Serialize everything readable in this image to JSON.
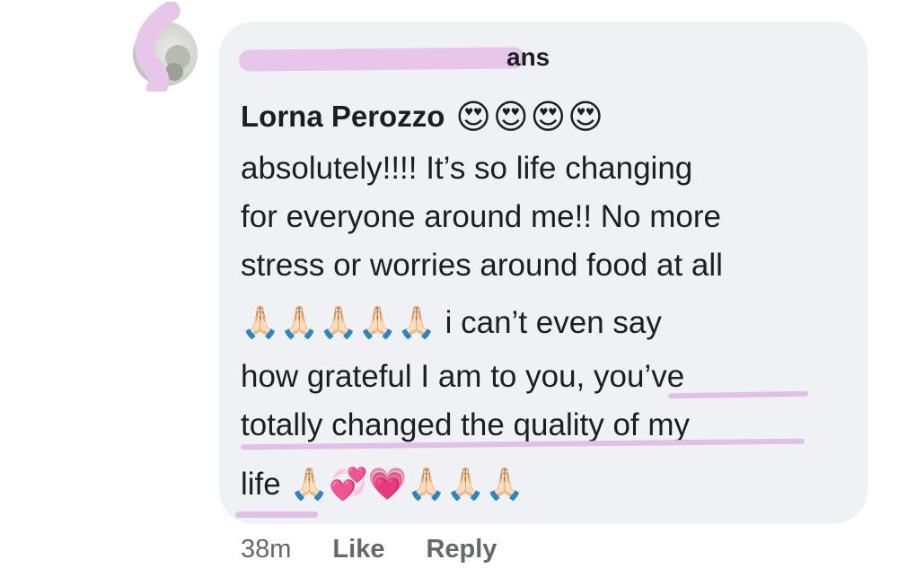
{
  "comment": {
    "redacted_name_tail": "ans",
    "author": "Lorna Perozzo",
    "author_emojis": "😍😍😍😍",
    "lines": [
      "absolutely!!!! It’s so life changing",
      "for everyone around me!! No more",
      "stress or worries around food at all",
      "🙏🏻🙏🏻🙏🏻🙏🏻🙏🏻 i can’t even say",
      "how grateful I am to you, you’ve",
      "totally changed the quality of my",
      "life 🙏🏻💞💗🙏🏻🙏🏻🙏🏻"
    ]
  },
  "meta": {
    "time": "38m",
    "like_label": "Like",
    "reply_label": "Reply"
  },
  "colors": {
    "bubble": "#eff1f4",
    "highlight": "#e1bfe6",
    "meta_text": "#65676b"
  },
  "icons": {
    "avatar": "profile-photo"
  }
}
